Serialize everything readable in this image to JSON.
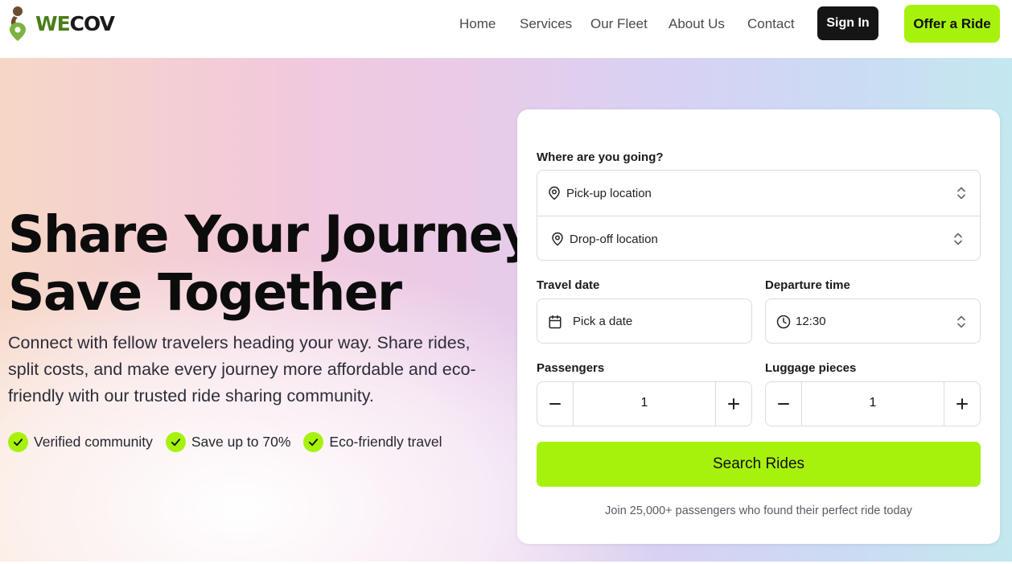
{
  "brand": {
    "name_part1": "WE",
    "name_part2": "COV",
    "accent_color": "#a7f20c",
    "logo_green": "#4a7d1c"
  },
  "nav": {
    "items": [
      "Home",
      "Services",
      "Our Fleet",
      "About Us",
      "Contact"
    ]
  },
  "header": {
    "sign_in_label": "Sign In",
    "offer_ride_label": "Offer a Ride"
  },
  "hero": {
    "headline_line1": "Share Your Journey,",
    "headline_line2": "Save Together",
    "subtext": "Connect with fellow travelers heading your way. Share rides, split costs, and make every journey more affordable and eco-friendly with our trusted ride sharing community.",
    "features": [
      "Verified community",
      "Save up to 70%",
      "Eco-friendly travel"
    ]
  },
  "search_form": {
    "destination_label": "Where are you going?",
    "pickup_placeholder": "Pick-up location",
    "dropoff_placeholder": "Drop-off location",
    "travel_date_label": "Travel date",
    "travel_date_placeholder": "Pick a date",
    "departure_time_label": "Departure time",
    "departure_time_value": "12:30",
    "passengers_label": "Passengers",
    "passengers_value": "1",
    "luggage_label": "Luggage pieces",
    "luggage_value": "1",
    "search_button_label": "Search Rides",
    "footnote": "Join 25,000+ passengers who found their perfect ride today"
  }
}
